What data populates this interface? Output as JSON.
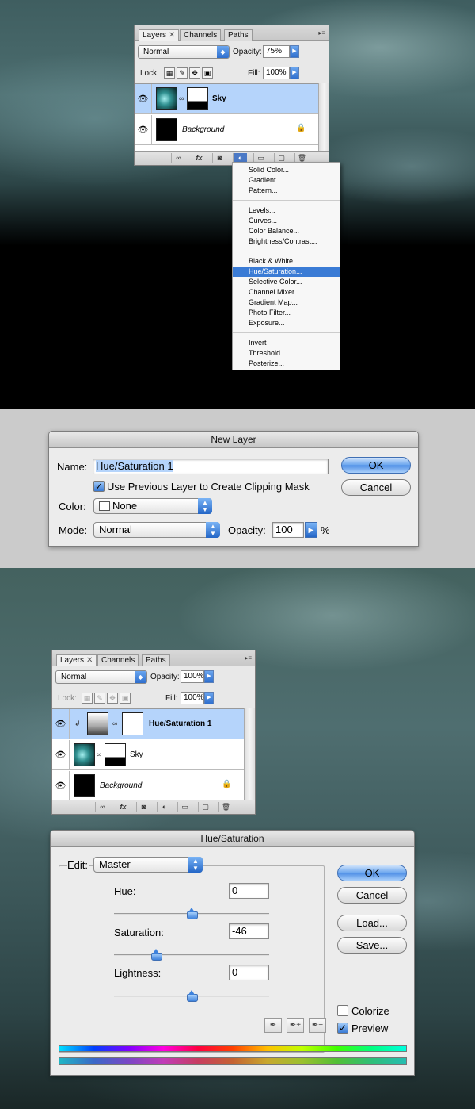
{
  "panel1": {
    "tabs": [
      "Layers",
      "Channels",
      "Paths"
    ],
    "tab_close": "✕",
    "blend_mode": "Normal",
    "opacity_label": "Opacity:",
    "opacity": "75%",
    "lock_label": "Lock:",
    "fill_label": "Fill:",
    "fill": "100%",
    "layers": [
      {
        "name": "Sky"
      },
      {
        "name": "Background"
      }
    ]
  },
  "adjust_menu": {
    "items": [
      "Solid Color...",
      "Gradient...",
      "Pattern...",
      "Levels...",
      "Curves...",
      "Color Balance...",
      "Brightness/Contrast...",
      "Black & White...",
      "Hue/Saturation...",
      "Selective Color...",
      "Channel Mixer...",
      "Gradient Map...",
      "Photo Filter...",
      "Exposure...",
      "Invert",
      "Threshold...",
      "Posterize..."
    ],
    "highlighted": "Hue/Saturation..."
  },
  "new_layer": {
    "title": "New Layer",
    "name_label": "Name:",
    "name_value": "Hue/Saturation 1",
    "clip_label": "Use Previous Layer to Create Clipping Mask",
    "color_label": "Color:",
    "color_value": "None",
    "mode_label": "Mode:",
    "mode_value": "Normal",
    "opacity_label": "Opacity:",
    "opacity_value": "100",
    "percent": "%",
    "ok": "OK",
    "cancel": "Cancel"
  },
  "panel2": {
    "tabs": [
      "Layers",
      "Channels",
      "Paths"
    ],
    "tab_close": "✕",
    "blend_mode": "Normal",
    "opacity_label": "Opacity:",
    "opacity": "100%",
    "lock_label": "Lock:",
    "fill_label": "Fill:",
    "fill": "100%",
    "layers": [
      {
        "name": "Hue/Saturation 1"
      },
      {
        "name": "Sky"
      },
      {
        "name": "Background"
      }
    ]
  },
  "hue_sat": {
    "title": "Hue/Saturation",
    "edit_label": "Edit:",
    "edit_value": "Master",
    "hue_label": "Hue:",
    "hue": "0",
    "saturation_label": "Saturation:",
    "saturation": "-46",
    "lightness_label": "Lightness:",
    "lightness": "0",
    "hue_level": 0.5,
    "saturation_level": 0.27,
    "lightness_level": 0.5,
    "ok": "OK",
    "cancel": "Cancel",
    "load": "Load...",
    "save": "Save...",
    "colorize": "Colorize",
    "preview": "Preview"
  }
}
